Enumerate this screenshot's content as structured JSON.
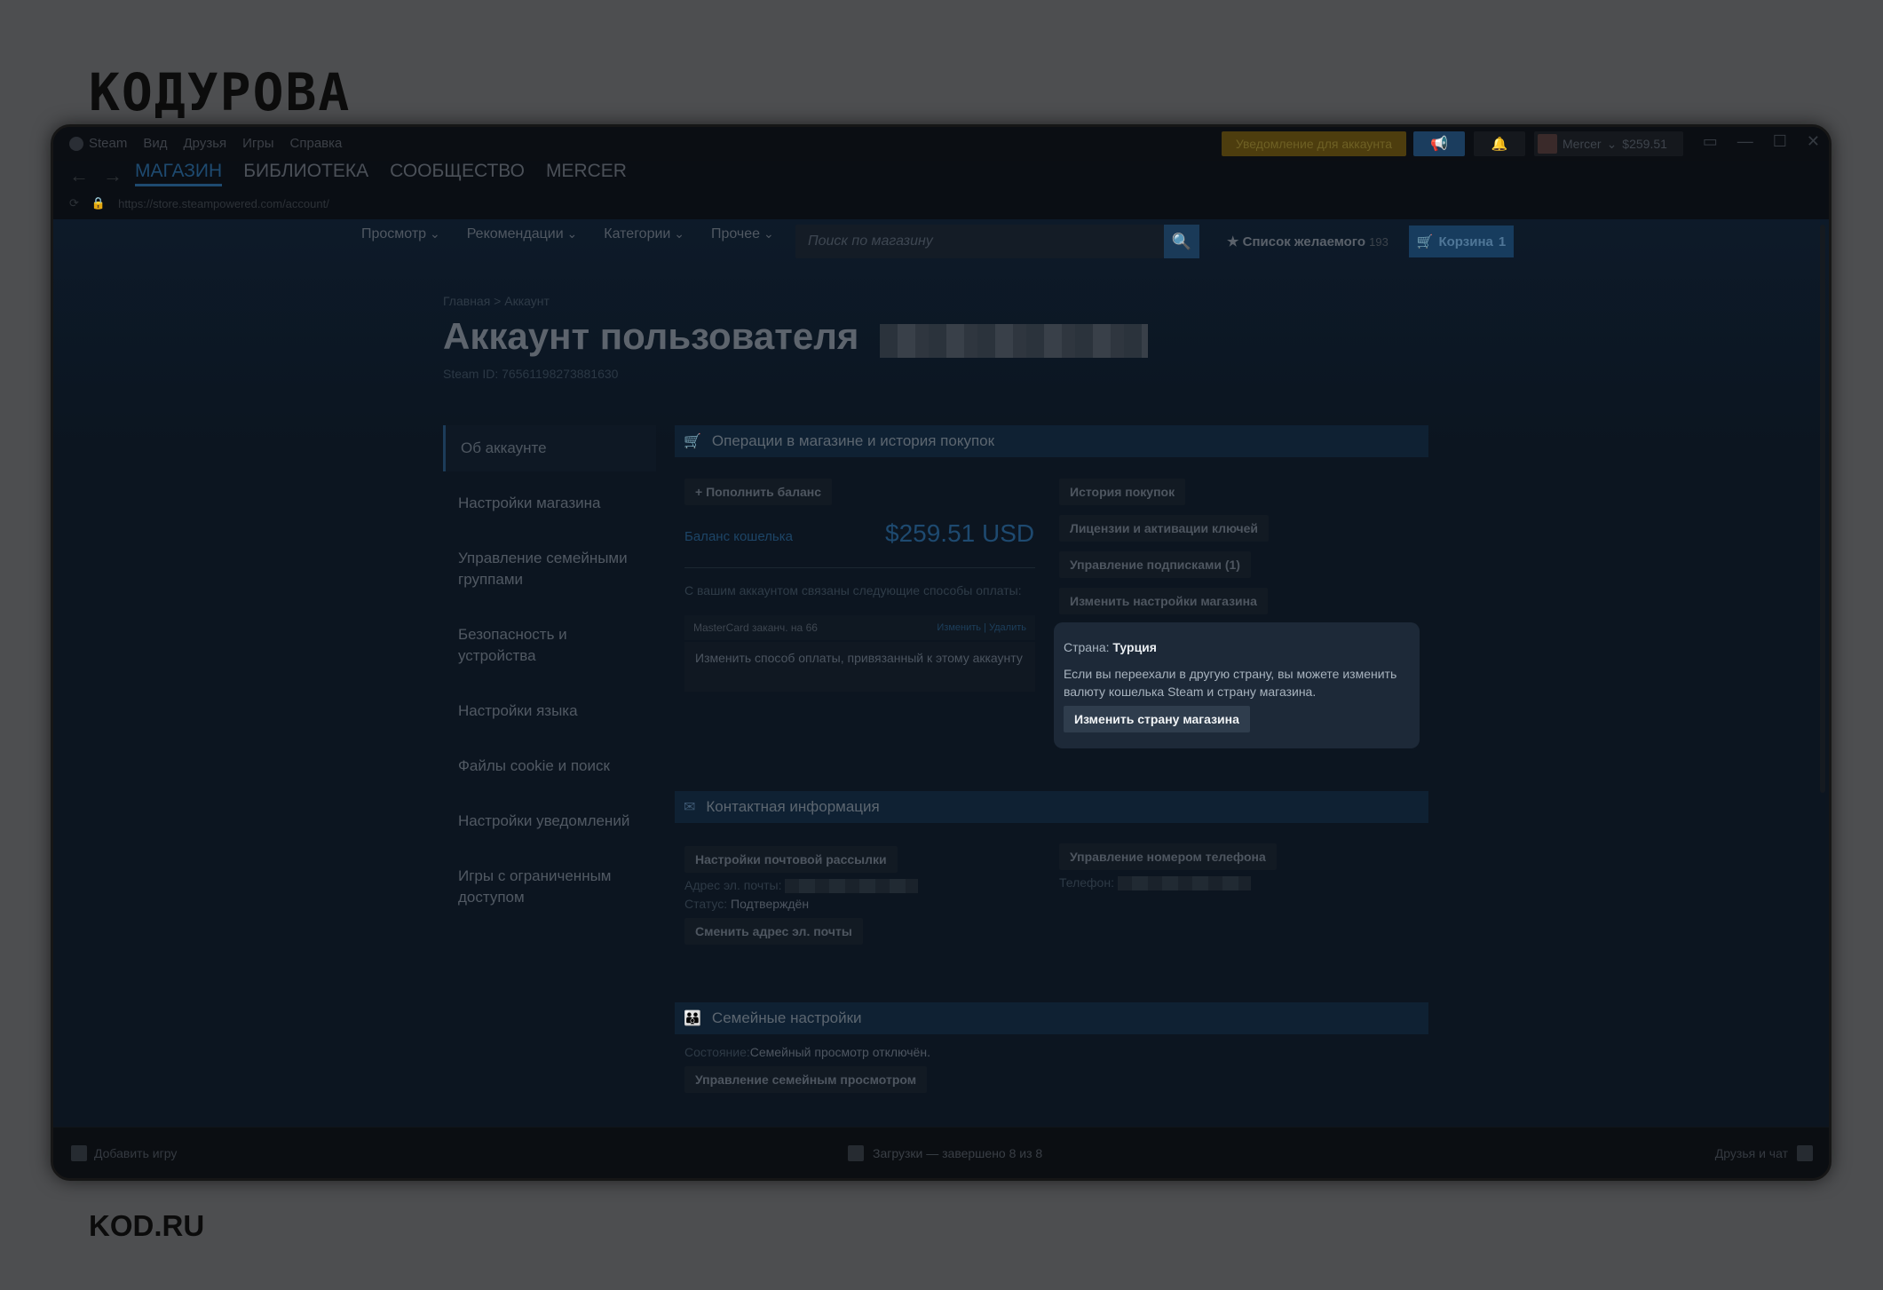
{
  "page": {
    "logo": "KOДУРОВА",
    "footer_logo": "KOD.RU"
  },
  "titlebar": {
    "menu": [
      "Steam",
      "Вид",
      "Друзья",
      "Игры",
      "Справка"
    ],
    "notification_label": "Уведомление для аккаунта",
    "user_name": "Mercer",
    "user_balance": "$259.51"
  },
  "nav": {
    "tabs": [
      "МАГАЗИН",
      "БИБЛИОТЕКА",
      "СООБЩЕСТВО",
      "MERCER"
    ],
    "url": "https://store.steampowered.com/account/"
  },
  "store_nav": {
    "items": [
      "Просмотр",
      "Рекомендации",
      "Категории",
      "Прочее"
    ],
    "search_placeholder": "Поиск по магазину",
    "wishlist_label": "Список желаемого",
    "wishlist_count": "193",
    "cart_label": "Корзина",
    "cart_count": "1"
  },
  "header": {
    "breadcrumb": "Главная > Аккаунт",
    "title": "Аккаунт пользователя",
    "steam_id": "Steam ID: 76561198273881630"
  },
  "sidebar": {
    "items": [
      "Об аккаунте",
      "Настройки магазина",
      "Управление семейными группами",
      "Безопасность и устройства",
      "Настройки языка",
      "Файлы cookie и поиск",
      "Настройки уведомлений",
      "Игры с ограниченным доступом"
    ]
  },
  "store_section": {
    "title": "Операции в магазине и история покупок",
    "add_funds": "+ Пополнить баланс",
    "wallet_label": "Баланс кошелька",
    "wallet_value": "$259.51 USD",
    "payment_note": "С вашим аккаунтом связаны следующие способы оплаты:",
    "card_text": "MasterCard заканч. на 66",
    "card_edit": "Изменить",
    "card_delete": "Удалить",
    "change_payment": "Изменить способ оплаты, привязанный к этому аккаунту",
    "links": [
      "История покупок",
      "Лицензии и активации ключей",
      "Управление подписками (1)",
      "Изменить настройки магазина"
    ],
    "country_label": "Страна:",
    "country_value": "Турция",
    "country_desc": "Если вы переехали в другую страну, вы можете изменить валюту кошелька Steam и страну магазина.",
    "country_button": "Изменить страну магазина"
  },
  "contact_section": {
    "title": "Контактная информация",
    "newsletter_button": "Настройки почтовой рассылки",
    "email_label": "Адрес эл. почты:",
    "status_label": "Статус:",
    "status_value": "Подтверждён",
    "change_email_button": "Сменить адрес эл. почты",
    "phone_button": "Управление номером телефона",
    "phone_label": "Телефон:"
  },
  "family_section": {
    "title": "Семейные настройки",
    "state_label": "Состояние:",
    "state_value": "Семейный просмотр отключён.",
    "manage_button": "Управление семейным просмотром"
  },
  "bottombar": {
    "add_game": "Добавить игру",
    "downloads": "Загрузки — завершено 8 из 8",
    "friends": "Друзья и чат"
  }
}
